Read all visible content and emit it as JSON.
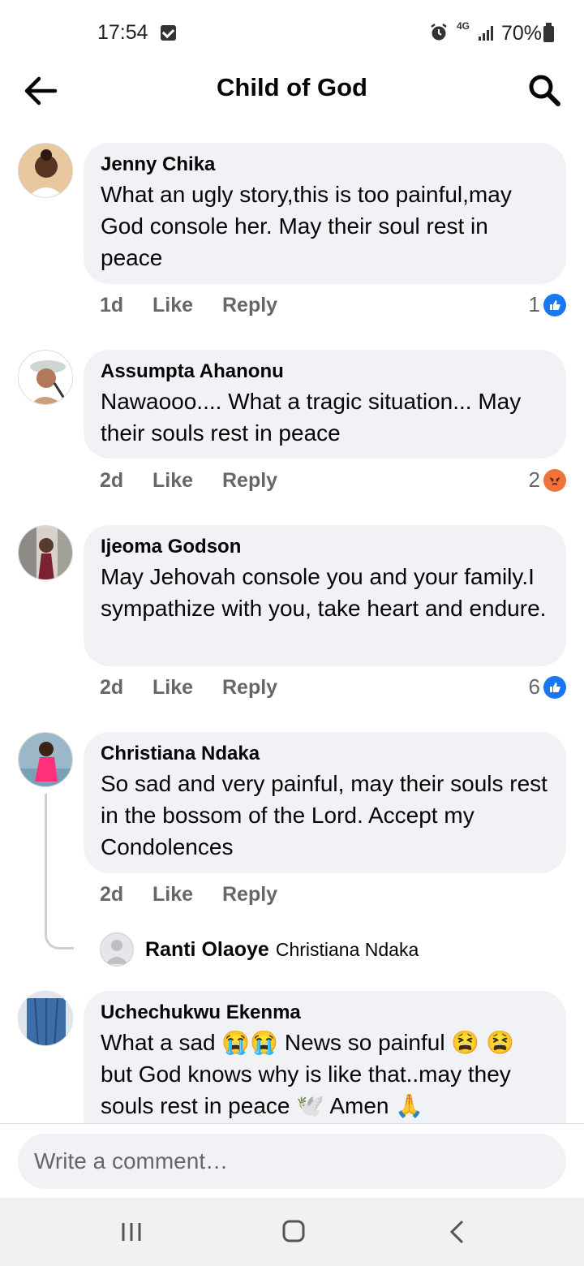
{
  "status_bar": {
    "time": "17:54",
    "network": "4G",
    "battery": "70%"
  },
  "header": {
    "title": "Child of God"
  },
  "comments": [
    {
      "author": "Jenny Chika",
      "text": "What an ugly story,this is too painful,may God console her. May their soul rest in peace",
      "age": "1d",
      "like_label": "Like",
      "reply_label": "Reply",
      "reaction_count": "1",
      "reaction_icon": "like-icon"
    },
    {
      "author": "Assumpta Ahanonu",
      "text": "Nawaooo.... What a tragic situation... May their souls rest in peace",
      "age": "2d",
      "like_label": "Like",
      "reply_label": "Reply",
      "reaction_count": "2",
      "reaction_icon": "angry-icon"
    },
    {
      "author": "Ijeoma Godson",
      "text": "May Jehovah console you and your family.I sympathize with you, take heart and endure.",
      "age": "2d",
      "like_label": "Like",
      "reply_label": "Reply",
      "reaction_count": "6",
      "reaction_icon": "like-icon"
    },
    {
      "author": "Christiana Ndaka",
      "text": "So sad and very painful, may their souls rest in the bossom of the Lord. Accept my Condolences",
      "age": "2d",
      "like_label": "Like",
      "reply_label": "Reply",
      "reply": {
        "author": "Ranti Olaoye",
        "preview": "Christiana Ndaka"
      }
    },
    {
      "author": "Uchechukwu Ekenma",
      "text_part1": "What a sad ",
      "text_part2": " News so painful ",
      "text_part3": " but God knows why is like that..may they souls rest in peace ",
      "text_part4": " Amen "
    }
  ],
  "composer": {
    "placeholder": "Write a comment…"
  },
  "colors": {
    "bubble": "#f0f2f5",
    "meta": "#65676b",
    "like_blue": "#1877f2",
    "angry_orange": "#f0733b"
  }
}
